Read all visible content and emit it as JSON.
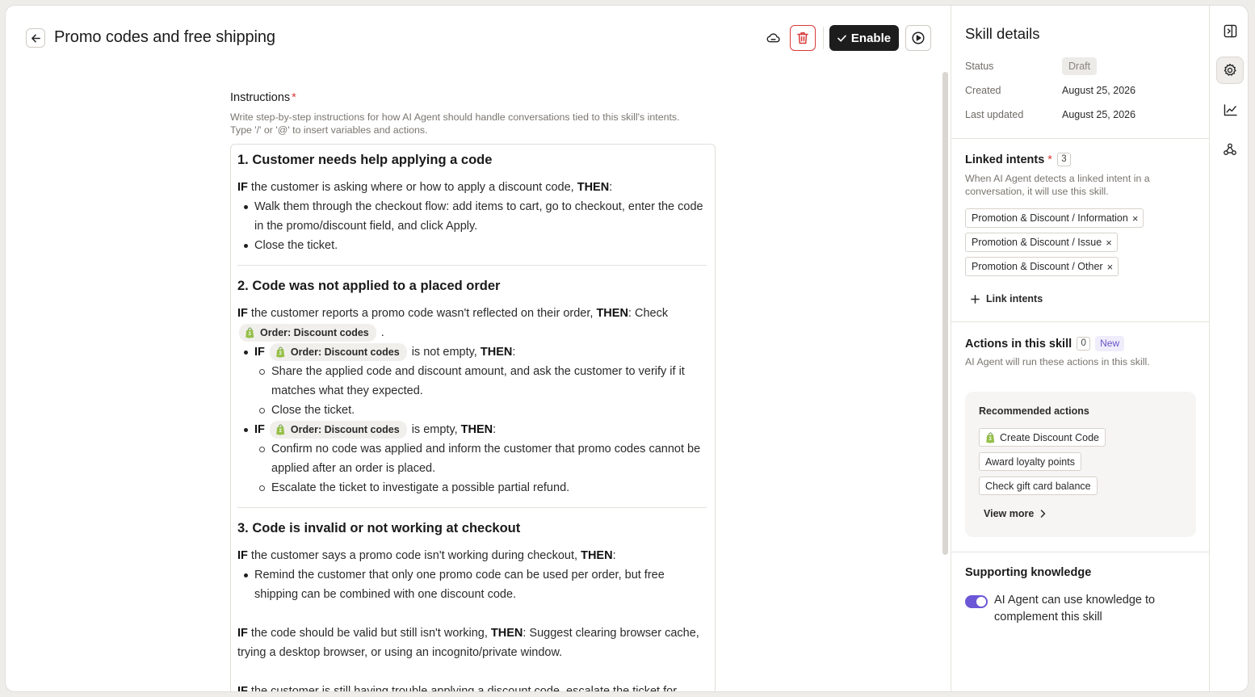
{
  "header": {
    "title": "Promo codes and free shipping",
    "enable_label": "Enable",
    "icons": [
      "arrow-left-icon",
      "cloud-icon",
      "trash-icon",
      "check-icon",
      "play-circle-icon"
    ]
  },
  "instructions": {
    "label": "Instructions",
    "required_mark": "*",
    "help_line1": "Write step-by-step instructions for how AI Agent should handle conversations tied to this skill's intents.",
    "help_line2": "Type '/' or '@' to insert variables and actions.",
    "variable_chip": "Order: Discount codes",
    "if": "IF",
    "then": "THEN",
    "s1": {
      "heading": "1. Customer needs help applying a code",
      "cond": " the customer is asking where or how to apply a discount code, ",
      "colon": ":",
      "b1": "Walk them through the checkout flow: add items to cart, go to checkout, enter the code in the promo/discount field, and click Apply.",
      "b2": "Close the ticket."
    },
    "s2": {
      "heading": "2. Code was not applied to a placed order",
      "cond": " the customer reports a promo code wasn't reflected on their order, ",
      "check": ": Check",
      "dot": ".",
      "notempty": " is not empty, ",
      "empty": " is empty, ",
      "colon": ":",
      "a1": "Share the applied code and discount amount, and ask the customer to verify if it matches what they expected.",
      "a2": "Close the ticket.",
      "c1": "Confirm no code was applied and inform the customer that promo codes cannot be applied after an order is placed.",
      "c2": "Escalate the ticket to investigate a possible partial refund."
    },
    "s3": {
      "heading": "3. Code is invalid or not working at checkout",
      "cond": " the customer says a promo code isn't working during checkout, ",
      "colon": ":",
      "b1": "Remind the customer that only one promo code can be used per order, but free shipping can be combined with one discount code.",
      "p2_cond": " the code should be valid but still isn't working, ",
      "p2_rest": ": Suggest clearing browser cache, trying a desktop browser, or using an incognito/private window.",
      "p3_cond": " the customer is still having trouble applying a discount code, escalate the ticket for"
    }
  },
  "details": {
    "title": "Skill details",
    "status_label": "Status",
    "status_value": "Draft",
    "created_label": "Created",
    "created_value": "August 25, 2026",
    "updated_label": "Last updated",
    "updated_value": "August 25, 2026",
    "linked_intents": {
      "title": "Linked intents",
      "required_mark": "*",
      "count": "3",
      "help": "When AI Agent detects a linked intent in a conversation, it will use this skill.",
      "items": [
        "Promotion & Discount / Information",
        "Promotion & Discount / Issue",
        "Promotion & Discount / Other"
      ],
      "remove_glyph": "×",
      "link_label": "Link intents"
    },
    "actions": {
      "title": "Actions in this skill",
      "count": "0",
      "new_badge": "New",
      "help": "AI Agent will run these actions in this skill.",
      "recommended_title": "Recommended actions",
      "items": [
        "Create Discount Code",
        "Award loyalty points",
        "Check gift card balance"
      ],
      "view_more": "View more"
    },
    "knowledge": {
      "title": "Supporting knowledge",
      "toggle_label": "AI Agent can use knowledge to complement this skill",
      "toggle_on": true
    }
  },
  "rail": {
    "icons": [
      "sidebar-toggle-icon",
      "gear-icon",
      "chart-icon",
      "webhook-icon"
    ],
    "active": "gear-icon"
  },
  "colors": {
    "accent": "#6c57d6",
    "danger": "#d83a3a",
    "shopify_green": "#95bf47",
    "primary_button": "#1d1d1d"
  }
}
